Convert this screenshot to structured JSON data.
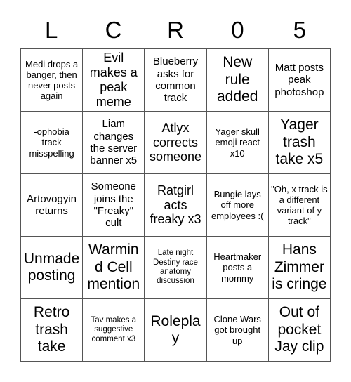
{
  "card": {
    "header_letters": [
      "L",
      "C",
      "R",
      "0",
      "5"
    ],
    "columns": 5,
    "rows": 5,
    "border_color": "#555555",
    "background_color": "#ffffff",
    "text_color": "#000000",
    "cells": [
      {
        "text": "Medi drops a banger, then never posts again",
        "size": "sm"
      },
      {
        "text": "Evil makes a peak meme",
        "size": "lg"
      },
      {
        "text": "Blueberry asks for common track",
        "size": "md"
      },
      {
        "text": "New rule added",
        "size": "xl"
      },
      {
        "text": "Matt posts peak photoshop",
        "size": "md"
      },
      {
        "text": "-ophobia track misspelling",
        "size": "sm"
      },
      {
        "text": "Liam changes the server banner x5",
        "size": "md"
      },
      {
        "text": "Atlyx corrects someone",
        "size": "lg"
      },
      {
        "text": "Yager skull emoji react x10",
        "size": "sm"
      },
      {
        "text": "Yager trash take x5",
        "size": "xl"
      },
      {
        "text": "Artovogyin returns",
        "size": "md"
      },
      {
        "text": "Someone joins the \"Freaky\" cult",
        "size": "md"
      },
      {
        "text": "Ratgirl acts freaky x3",
        "size": "lg"
      },
      {
        "text": "Bungie lays off more employees :(",
        "size": "sm"
      },
      {
        "text": "\"Oh, x track is a different variant of y track\"",
        "size": "sm"
      },
      {
        "text": "Unmade posting",
        "size": "xl"
      },
      {
        "text": "Warmind Cell mention",
        "size": "xl"
      },
      {
        "text": "Late night Destiny race anatomy discussion",
        "size": "xs"
      },
      {
        "text": "Heartmaker posts a mommy",
        "size": "sm"
      },
      {
        "text": "Hans Zimmer is cringe",
        "size": "xl"
      },
      {
        "text": "Retro trash take",
        "size": "xl"
      },
      {
        "text": "Tav makes a suggestive comment x3",
        "size": "xs"
      },
      {
        "text": "Roleplay",
        "size": "xl"
      },
      {
        "text": "Clone Wars got brought up",
        "size": "sm"
      },
      {
        "text": "Out of pocket Jay clip",
        "size": "xl"
      }
    ]
  }
}
